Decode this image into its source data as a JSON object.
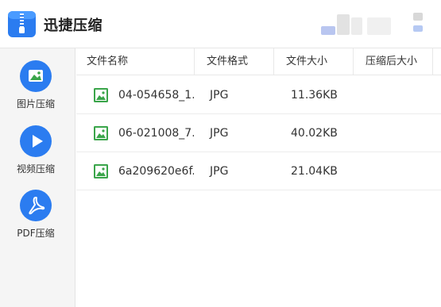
{
  "app": {
    "title": "迅捷压缩"
  },
  "colors": {
    "accent": "#2b7cf0",
    "image_icon": "#3aa54a"
  },
  "sidebar": {
    "items": [
      {
        "label": "图片压缩",
        "icon": "image-icon"
      },
      {
        "label": "视频压缩",
        "icon": "play-icon"
      },
      {
        "label": "PDF压缩",
        "icon": "pdf-icon"
      }
    ]
  },
  "table": {
    "columns": [
      "文件名称",
      "文件格式",
      "文件大小",
      "压缩后大小"
    ],
    "rows": [
      {
        "name": "04-054658_1...",
        "format": "JPG",
        "size": "11.36KB",
        "compressed": ""
      },
      {
        "name": "06-021008_7...",
        "format": "JPG",
        "size": "40.02KB",
        "compressed": ""
      },
      {
        "name": "6a209620e6f...",
        "format": "JPG",
        "size": "21.04KB",
        "compressed": ""
      }
    ]
  }
}
